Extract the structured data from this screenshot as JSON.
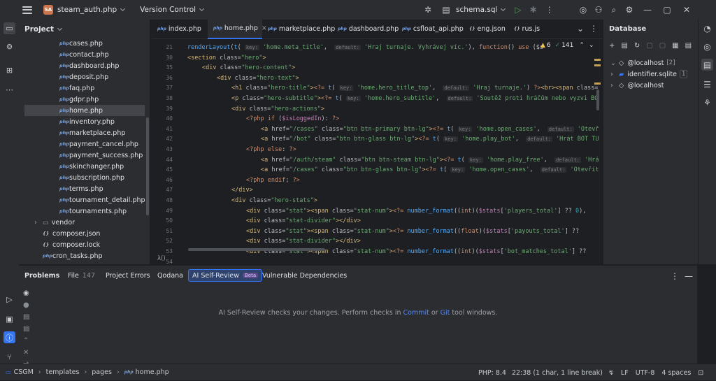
{
  "topbar": {
    "project_badge": "SA",
    "project_name": "steam_auth.php",
    "vcs": "Version Control",
    "run_config": "schema.sql"
  },
  "project_panel": {
    "title": "Project",
    "items": [
      {
        "label": "cases.php",
        "type": "php"
      },
      {
        "label": "contact.php",
        "type": "php"
      },
      {
        "label": "dashboard.php",
        "type": "php"
      },
      {
        "label": "deposit.php",
        "type": "php"
      },
      {
        "label": "faq.php",
        "type": "php"
      },
      {
        "label": "gdpr.php",
        "type": "php"
      },
      {
        "label": "home.php",
        "type": "php",
        "selected": true
      },
      {
        "label": "inventory.php",
        "type": "php"
      },
      {
        "label": "marketplace.php",
        "type": "php"
      },
      {
        "label": "payment_cancel.php",
        "type": "php"
      },
      {
        "label": "payment_success.php",
        "type": "php"
      },
      {
        "label": "skinchanger.php",
        "type": "php"
      },
      {
        "label": "subscription.php",
        "type": "php"
      },
      {
        "label": "terms.php",
        "type": "php"
      },
      {
        "label": "tournament_detail.php",
        "type": "php"
      },
      {
        "label": "tournaments.php",
        "type": "php"
      },
      {
        "label": "vendor",
        "type": "folder"
      },
      {
        "label": "composer.json",
        "type": "json"
      },
      {
        "label": "composer.lock",
        "type": "json"
      },
      {
        "label": "cron_tasks.php",
        "type": "php"
      }
    ]
  },
  "editor": {
    "tabs": [
      {
        "label": "index.php",
        "type": "php"
      },
      {
        "label": "home.php",
        "type": "php",
        "active": true
      },
      {
        "label": "marketplace.php",
        "type": "php"
      },
      {
        "label": "dashboard.php",
        "type": "php"
      },
      {
        "label": "csfloat_api.php",
        "type": "php"
      },
      {
        "label": "eng.json",
        "type": "json"
      },
      {
        "label": "rus.js",
        "type": "json"
      }
    ],
    "warnings": "6",
    "checks": "141",
    "line_numbers": [
      "21",
      "30",
      "35",
      "36",
      "37",
      "38",
      "39",
      "40",
      "41",
      "42",
      "43",
      "44",
      "45",
      "46",
      "47",
      "48",
      "49",
      "50",
      "51",
      "52",
      "53",
      "54"
    ],
    "breadcrumb": "λ()"
  },
  "database": {
    "title": "Database",
    "items": [
      {
        "label": "@localhost",
        "badge": "[2]",
        "level": 0
      },
      {
        "label": "identifier.sqlite",
        "badge": "1",
        "level": 0
      },
      {
        "label": "@localhost",
        "badge": "",
        "level": 0
      }
    ]
  },
  "bottom": {
    "tabs": [
      {
        "label": "Problems",
        "bold": true
      },
      {
        "label": "File",
        "count": "147"
      },
      {
        "label": "Project Errors"
      },
      {
        "label": "Qodana"
      },
      {
        "label": "AI Self-Review",
        "badge": "Beta",
        "active": true
      },
      {
        "label": "Vulnerable Dependencies"
      }
    ],
    "message_pre": "AI Self-Review checks your changes. Perform checks in ",
    "link1": "Commit",
    "mid": " or ",
    "link2": "Git",
    "message_post": " tool windows."
  },
  "status": {
    "crumbs": [
      "CSGM",
      "templates",
      "pages",
      "home.php"
    ],
    "php": "PHP: 8.4",
    "position": "22:38 (1 char, 1 line break)",
    "eol": "LF",
    "encoding": "UTF-8",
    "indent": "4 spaces"
  },
  "colors": {
    "accent": "#3574f0",
    "bg": "#1e1f22",
    "panel": "#2b2d30"
  }
}
